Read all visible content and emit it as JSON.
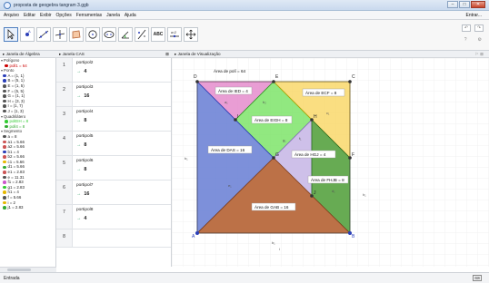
{
  "window": {
    "title": "proposta de geogebra tangram 3.ggb"
  },
  "menu": {
    "items": [
      "Arquivo",
      "Editar",
      "Exibir",
      "Opções",
      "Ferramentas",
      "Janela",
      "Ajuda"
    ],
    "signin": "Entrar..."
  },
  "toolbar": {
    "tools": [
      "move-tool",
      "point-tool",
      "line-tool",
      "perpendicular-tool",
      "polygon-tool",
      "circle-tool",
      "ellipse-tool",
      "angle-tool",
      "reflect-tool",
      "text-tool",
      "slider-tool",
      "move-view-tool"
    ],
    "text_tool_label": "ABC",
    "slider_label": "a=2"
  },
  "panels": {
    "algebra_title": "Janela de Álgebra",
    "cas_title": "Janela CAS",
    "graphics_title": "Janela de Visualização"
  },
  "algebra": [
    {
      "label": "Polígono",
      "type": "cat"
    },
    {
      "label": "poll1 = 64",
      "color": "#cc0000",
      "type": "sub"
    },
    {
      "label": "Ponto",
      "type": "cat"
    },
    {
      "label": "A = (1, 1)",
      "color": "#2b3fb8"
    },
    {
      "label": "B = (5, 1)",
      "color": "#2b3fb8"
    },
    {
      "label": "E = (1, 5)",
      "color": "#555555"
    },
    {
      "label": "F = (5, 5)",
      "color": "#555555"
    },
    {
      "label": "G = (1, 1)",
      "color": "#555555"
    },
    {
      "label": "H = (3, 3)",
      "color": "#555555"
    },
    {
      "label": "I = (1, 7)",
      "color": "#555555"
    },
    {
      "label": "J = (1, 3)",
      "color": "#555555"
    },
    {
      "label": "Quadrilátero",
      "type": "cat"
    },
    {
      "label": "polEIH = 8",
      "color": "#33cc33",
      "type": "sub"
    },
    {
      "label": "poll4 = 8",
      "color": "#33aa33",
      "type": "sub"
    },
    {
      "label": "Segmento",
      "type": "cat"
    },
    {
      "label": "a = 8",
      "color": "#555555"
    },
    {
      "label": "a1 = 5.66",
      "color": "#c55"
    },
    {
      "label": "a2 = 5.66",
      "color": "#c55"
    },
    {
      "label": "b1 = 4",
      "color": "#2b3fb8"
    },
    {
      "label": "b2 = 5.66",
      "color": "#c55"
    },
    {
      "label": "c1 = 5.66",
      "color": "#e5b800"
    },
    {
      "label": "d1 = 5.66",
      "color": "#33aa33"
    },
    {
      "label": "e1 = 2.83",
      "color": "#c55"
    },
    {
      "label": "e = 11.31",
      "color": "#555555"
    },
    {
      "label": "f1 = 2.83",
      "color": "#cc55cc"
    },
    {
      "label": "g1 = 2.83",
      "color": "#33cc33"
    },
    {
      "label": "h1 = 4",
      "color": "#e5b800"
    },
    {
      "label": "f = 5.66",
      "color": "#555555"
    },
    {
      "label": "i = 2",
      "color": "#e5b800"
    },
    {
      "label": "j1 = 2.83",
      "color": "#33aa33"
    }
  ],
  "cas": [
    {
      "num": "1",
      "input": "portipol2",
      "output": "4"
    },
    {
      "num": "2",
      "input": "portipol3",
      "output": "16"
    },
    {
      "num": "3",
      "input": "portipol4",
      "output": "8"
    },
    {
      "num": "4",
      "input": "portipol5",
      "output": "8"
    },
    {
      "num": "5",
      "input": "portipol6",
      "output": "8"
    },
    {
      "num": "6",
      "input": "portipol7",
      "output": "16"
    },
    {
      "num": "7",
      "input": "portipol8",
      "output": "4"
    },
    {
      "num": "8",
      "input": "",
      "output": ""
    }
  ],
  "graph": {
    "labels": {
      "area_total": "Área de polí = 64",
      "area_ied": "Área de IED = 4",
      "area_ecf": "Área de ECF = 8",
      "area_eih": "Área de EIGH = 8",
      "area_das": "Área de DAS = 16",
      "area_hgj": "Área de HGJ = 4",
      "area_fhjb": "Área de FHJB = 8",
      "area_gab": "Área de GAB = 16"
    },
    "points": {
      "D": "D",
      "E": "E",
      "C": "C",
      "I": "I",
      "H": "H",
      "G": "G",
      "J": "J",
      "F": "F",
      "A": "A",
      "B": "B"
    },
    "colors": {
      "pink": "#e58ccd",
      "yellow": "#f9d86b",
      "green": "#7ee46a",
      "blue": "#6f84d6",
      "lavender": "#cbbde8",
      "darkgreen": "#5fa64a",
      "brown": "#b8693d"
    }
  },
  "status": {
    "input_label": "Entrada"
  }
}
